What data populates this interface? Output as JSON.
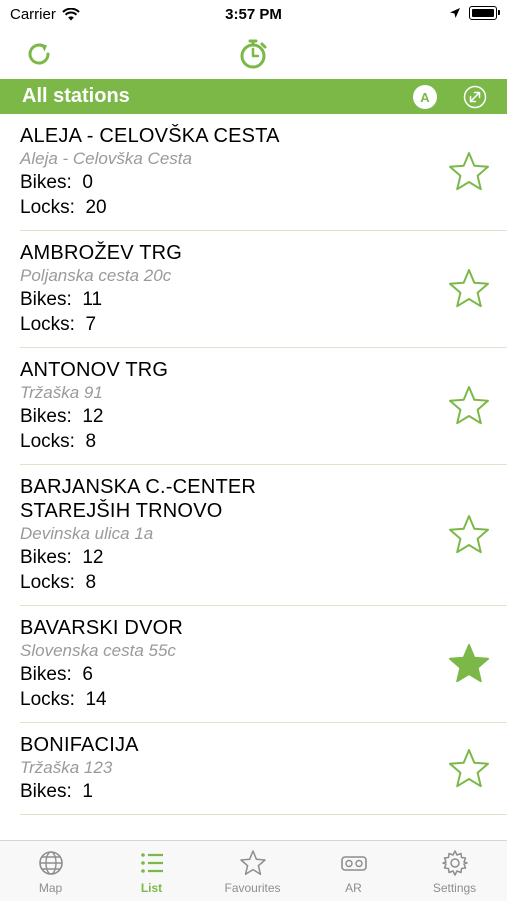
{
  "status_bar": {
    "carrier": "Carrier",
    "time": "3:57 PM"
  },
  "header": {
    "title": "All stations",
    "sort_label": "A"
  },
  "labels": {
    "bikes": "Bikes:",
    "locks": "Locks:"
  },
  "stations": [
    {
      "name": "ALEJA - CELOVŠKA CESTA",
      "address": "Aleja - Celovška Cesta",
      "bikes": "0",
      "locks": "20",
      "favourite": false
    },
    {
      "name": "AMBROŽEV TRG",
      "address": "Poljanska cesta 20c",
      "bikes": "11",
      "locks": "7",
      "favourite": false
    },
    {
      "name": "ANTONOV TRG",
      "address": "Tržaška 91",
      "bikes": "12",
      "locks": "8",
      "favourite": false
    },
    {
      "name": "BARJANSKA C.-CENTER STAREJŠIH TRNOVO",
      "address": "Devinska ulica 1a",
      "bikes": "12",
      "locks": "8",
      "favourite": false
    },
    {
      "name": "BAVARSKI DVOR",
      "address": "Slovenska cesta 55c",
      "bikes": "6",
      "locks": "14",
      "favourite": true
    },
    {
      "name": "BONIFACIJA",
      "address": "Tržaška 123",
      "bikes": "1",
      "locks": "",
      "favourite": false
    }
  ],
  "tabs": [
    {
      "label": "Map",
      "icon": "globe-icon",
      "active": false
    },
    {
      "label": "List",
      "icon": "list-icon",
      "active": true
    },
    {
      "label": "Favourites",
      "icon": "star-icon",
      "active": false
    },
    {
      "label": "AR",
      "icon": "vr-headset-icon",
      "active": false
    },
    {
      "label": "Settings",
      "icon": "gear-icon",
      "active": false
    }
  ],
  "colors": {
    "accent": "#7cb848",
    "inactive": "#8e8e8e"
  }
}
